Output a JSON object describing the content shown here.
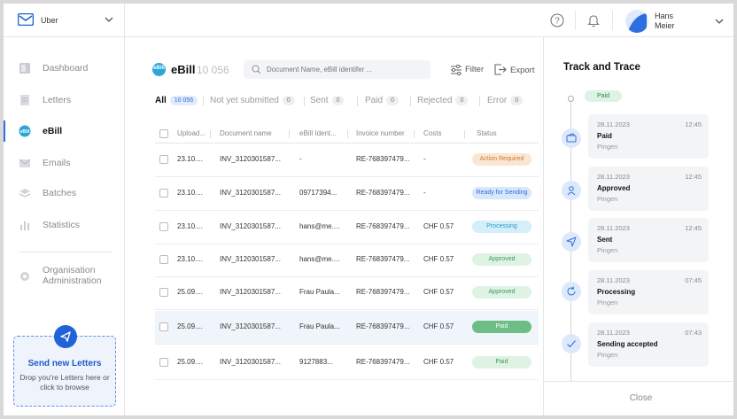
{
  "org": {
    "name": "Uber"
  },
  "user": {
    "first": "Hans",
    "last": "Meier"
  },
  "nav": [
    {
      "label": "Dashboard",
      "icon": "dashboard-icon"
    },
    {
      "label": "Letters",
      "icon": "letters-icon"
    },
    {
      "label": "eBill",
      "icon": "ebill-icon",
      "active": true
    },
    {
      "label": "Emails",
      "icon": "emails-icon"
    },
    {
      "label": "Batches",
      "icon": "batches-icon"
    },
    {
      "label": "Statistics",
      "icon": "statistics-icon"
    }
  ],
  "org_admin": {
    "line1": "Organisation",
    "line2": "Administration"
  },
  "send": {
    "title": "Send new Letters",
    "hint": "Drop you're Letters here or click to browse"
  },
  "page": {
    "logo_text": "eBill",
    "title": "eBill",
    "count": "10 056"
  },
  "search": {
    "placeholder": "Document Name, eBill identifer ..."
  },
  "toolbar": {
    "filter": "Filter",
    "export": "Export"
  },
  "tabs": [
    {
      "label": "All",
      "count": "10 056"
    },
    {
      "label": "Not yet submitted",
      "count": "0"
    },
    {
      "label": "Sent",
      "count": "0"
    },
    {
      "label": "Paid",
      "count": "0"
    },
    {
      "label": "Rejected",
      "count": "0"
    },
    {
      "label": "Error",
      "count": "0"
    }
  ],
  "columns": [
    "Upload...",
    "Document name",
    "eBill Ident...",
    "Invoice number",
    "Costs",
    "Status"
  ],
  "rows": [
    {
      "upload": "23.10....",
      "doc": "INV_3120301587...",
      "ident": "-",
      "invoice": "RE-768397479...",
      "cost": "-",
      "status": "Action Required",
      "kind": "action"
    },
    {
      "upload": "23.10....",
      "doc": "INV_3120301587...",
      "ident": "09717394...",
      "invoice": "RE-768397479...",
      "cost": "-",
      "status": "Ready for Sending",
      "kind": "ready"
    },
    {
      "upload": "23.10....",
      "doc": "INV_3120301587...",
      "ident": "hans@me....",
      "invoice": "RE-768397479...",
      "cost": "CHF 0.57",
      "status": "Processing",
      "kind": "processing"
    },
    {
      "upload": "23.10....",
      "doc": "INV_3120301587...",
      "ident": "hans@me....",
      "invoice": "RE-768397479...",
      "cost": "CHF 0.57",
      "status": "Approved",
      "kind": "approved"
    },
    {
      "upload": "25.09....",
      "doc": "INV_3120301587...",
      "ident": "Frau Paula...",
      "invoice": "RE-768397479...",
      "cost": "CHF 0.57",
      "status": "Approved",
      "kind": "approved"
    },
    {
      "upload": "25.09....",
      "doc": "INV_3120301587...",
      "ident": "Frau Paula...",
      "invoice": "RE-768397479...",
      "cost": "CHF 0.57",
      "status": "Paid",
      "kind": "paid-strong",
      "selected": true
    },
    {
      "upload": "25.09....",
      "doc": "INV_3120301587...",
      "ident": "9127883...",
      "invoice": "RE-768397479...",
      "cost": "CHF 0.57",
      "status": "Paid",
      "kind": "paid"
    }
  ],
  "status_colors": {
    "action": {
      "bg": "#fbe6d4",
      "fg": "#d17a2c"
    },
    "ready": {
      "bg": "#d9e7fb",
      "fg": "#2e6fe0"
    },
    "processing": {
      "bg": "#d4effa",
      "fg": "#2a9bc9"
    },
    "approved": {
      "bg": "#dff3e4",
      "fg": "#3c9a5a"
    },
    "paid-strong": {
      "bg": "#6cbe84",
      "fg": "#ffffff"
    },
    "paid": {
      "bg": "#dff3e4",
      "fg": "#3c9a5a"
    }
  },
  "panel": {
    "title": "Track and Trace",
    "current": "Paid",
    "events": [
      {
        "date": "28.11.2023",
        "time": "12:45",
        "status": "Paid",
        "by": "Pingen",
        "icon": "wallet-icon"
      },
      {
        "date": "28.11.2023",
        "time": "12:45",
        "status": "Approved",
        "by": "Pingen",
        "icon": "user-check-icon"
      },
      {
        "date": "28.11.2023",
        "time": "12:45",
        "status": "Sent",
        "by": "Pingen",
        "icon": "send-icon"
      },
      {
        "date": "28.11.2023",
        "time": "07:45",
        "status": "Processing",
        "by": "Pingen",
        "icon": "refresh-icon"
      },
      {
        "date": "28.11.2023",
        "time": "07:43",
        "status": "Sending accepted",
        "by": "Pingen",
        "icon": "check-icon"
      }
    ],
    "close": "Close"
  }
}
